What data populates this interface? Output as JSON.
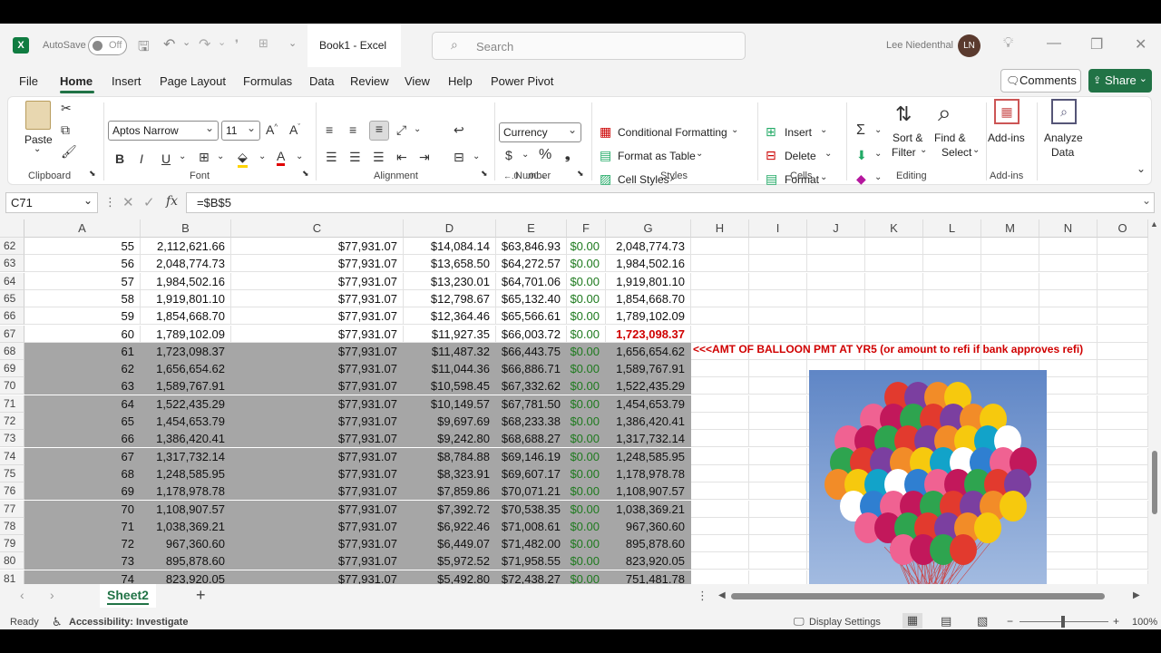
{
  "titlebar": {
    "autosave_label": "AutoSave",
    "autosave_state": "Off",
    "doc_title": "Book1  -  Excel",
    "search_placeholder": "Search",
    "user_name": "Lee Niedenthal",
    "user_initials": "LN"
  },
  "menu": {
    "items": [
      "File",
      "Home",
      "Insert",
      "Page Layout",
      "Formulas",
      "Data",
      "Review",
      "View",
      "Help",
      "Power Pivot"
    ],
    "comments": "Comments",
    "share": "Share"
  },
  "ribbon": {
    "clipboard": {
      "paste": "Paste",
      "label": "Clipboard"
    },
    "font": {
      "name": "Aptos Narrow",
      "size": "11",
      "label": "Font"
    },
    "alignment": {
      "label": "Alignment"
    },
    "number": {
      "format": "Currency",
      "label": "Number"
    },
    "styles": {
      "conditional": "Conditional Formatting",
      "format_table": "Format as Table",
      "cell_styles": "Cell Styles",
      "label": "Styles"
    },
    "cells": {
      "insert": "Insert",
      "delete": "Delete",
      "format": "Format",
      "label": "Cells"
    },
    "editing": {
      "sort1": "Sort &",
      "sort2": "Filter",
      "find1": "Find &",
      "find2": "Select",
      "label": "Editing"
    },
    "addins": {
      "name": "Add-ins",
      "label": "Add-ins"
    },
    "analyze": {
      "line1": "Analyze",
      "line2": "Data"
    }
  },
  "formula_bar": {
    "name_box": "C71",
    "fx": "fx",
    "formula": "=$B$5"
  },
  "columns": [
    "A",
    "B",
    "C",
    "D",
    "E",
    "F",
    "G",
    "H",
    "I",
    "J",
    "K",
    "L",
    "M",
    "N",
    "O"
  ],
  "rows": [
    {
      "r": "62",
      "a": "55",
      "b": "2,112,621.66",
      "c": "$77,931.07",
      "d": "$14,084.14",
      "e": "$63,846.93",
      "f": "$0.00",
      "g": "2,048,774.73"
    },
    {
      "r": "63",
      "a": "56",
      "b": "2,048,774.73",
      "c": "$77,931.07",
      "d": "$13,658.50",
      "e": "$64,272.57",
      "f": "$0.00",
      "g": "1,984,502.16"
    },
    {
      "r": "64",
      "a": "57",
      "b": "1,984,502.16",
      "c": "$77,931.07",
      "d": "$13,230.01",
      "e": "$64,701.06",
      "f": "$0.00",
      "g": "1,919,801.10"
    },
    {
      "r": "65",
      "a": "58",
      "b": "1,919,801.10",
      "c": "$77,931.07",
      "d": "$12,798.67",
      "e": "$65,132.40",
      "f": "$0.00",
      "g": "1,854,668.70"
    },
    {
      "r": "66",
      "a": "59",
      "b": "1,854,668.70",
      "c": "$77,931.07",
      "d": "$12,364.46",
      "e": "$65,566.61",
      "f": "$0.00",
      "g": "1,789,102.09"
    },
    {
      "r": "67",
      "a": "60",
      "b": "1,789,102.09",
      "c": "$77,931.07",
      "d": "$11,927.35",
      "e": "$66,003.72",
      "f": "$0.00",
      "g": "1,723,098.37"
    },
    {
      "r": "68",
      "a": "61",
      "b": "1,723,098.37",
      "c": "$77,931.07",
      "d": "$11,487.32",
      "e": "$66,443.75",
      "f": "$0.00",
      "g": "1,656,654.62"
    },
    {
      "r": "69",
      "a": "62",
      "b": "1,656,654.62",
      "c": "$77,931.07",
      "d": "$11,044.36",
      "e": "$66,886.71",
      "f": "$0.00",
      "g": "1,589,767.91"
    },
    {
      "r": "70",
      "a": "63",
      "b": "1,589,767.91",
      "c": "$77,931.07",
      "d": "$10,598.45",
      "e": "$67,332.62",
      "f": "$0.00",
      "g": "1,522,435.29"
    },
    {
      "r": "71",
      "a": "64",
      "b": "1,522,435.29",
      "c": "$77,931.07",
      "d": "$10,149.57",
      "e": "$67,781.50",
      "f": "$0.00",
      "g": "1,454,653.79"
    },
    {
      "r": "72",
      "a": "65",
      "b": "1,454,653.79",
      "c": "$77,931.07",
      "d": "$9,697.69",
      "e": "$68,233.38",
      "f": "$0.00",
      "g": "1,386,420.41"
    },
    {
      "r": "73",
      "a": "66",
      "b": "1,386,420.41",
      "c": "$77,931.07",
      "d": "$9,242.80",
      "e": "$68,688.27",
      "f": "$0.00",
      "g": "1,317,732.14"
    },
    {
      "r": "74",
      "a": "67",
      "b": "1,317,732.14",
      "c": "$77,931.07",
      "d": "$8,784.88",
      "e": "$69,146.19",
      "f": "$0.00",
      "g": "1,248,585.95"
    },
    {
      "r": "75",
      "a": "68",
      "b": "1,248,585.95",
      "c": "$77,931.07",
      "d": "$8,323.91",
      "e": "$69,607.17",
      "f": "$0.00",
      "g": "1,178,978.78"
    },
    {
      "r": "76",
      "a": "69",
      "b": "1,178,978.78",
      "c": "$77,931.07",
      "d": "$7,859.86",
      "e": "$70,071.21",
      "f": "$0.00",
      "g": "1,108,907.57"
    },
    {
      "r": "77",
      "a": "70",
      "b": "1,108,907.57",
      "c": "$77,931.07",
      "d": "$7,392.72",
      "e": "$70,538.35",
      "f": "$0.00",
      "g": "1,038,369.21"
    },
    {
      "r": "78",
      "a": "71",
      "b": "1,038,369.21",
      "c": "$77,931.07",
      "d": "$6,922.46",
      "e": "$71,008.61",
      "f": "$0.00",
      "g": "967,360.60"
    },
    {
      "r": "79",
      "a": "72",
      "b": "967,360.60",
      "c": "$77,931.07",
      "d": "$6,449.07",
      "e": "$71,482.00",
      "f": "$0.00",
      "g": "895,878.60"
    },
    {
      "r": "80",
      "a": "73",
      "b": "895,878.60",
      "c": "$77,931.07",
      "d": "$5,972.52",
      "e": "$71,958.55",
      "f": "$0.00",
      "g": "823,920.05"
    },
    {
      "r": "81",
      "a": "74",
      "b": "823,920.05",
      "c": "$77,931.07",
      "d": "$5,492.80",
      "e": "$72,438.27",
      "f": "$0.00",
      "g": "751,481.78"
    }
  ],
  "note": "<<<AMT OF BALLOON PMT AT YR5 (or amount to refi if bank approves refi)",
  "sheet": {
    "tab": "Sheet2",
    "add": "+"
  },
  "status": {
    "ready": "Ready",
    "accessibility": "Accessibility: Investigate",
    "display": "Display Settings",
    "zoom": "100%",
    "zoom_minus": "−",
    "zoom_plus": "+"
  },
  "colors": {
    "accent": "#217346",
    "shade": "#a6a6a6",
    "red": "#d00000",
    "green": "#1e7a1e"
  }
}
